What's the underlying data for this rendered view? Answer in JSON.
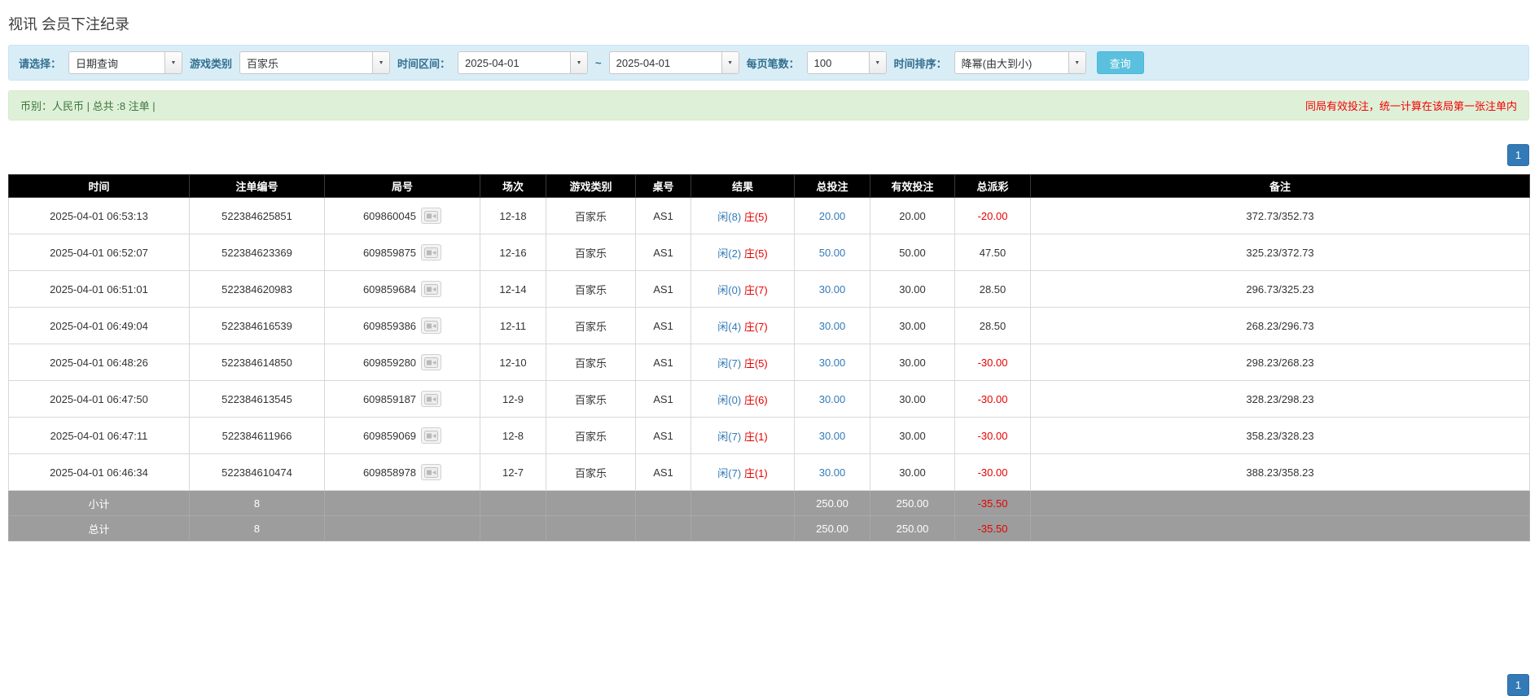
{
  "page": {
    "title": "视讯 会员下注纪录"
  },
  "filters": {
    "select_label": "请选择：",
    "select_value": "日期查询",
    "game_type_label": "游戏类别",
    "game_type_value": "百家乐",
    "date_range_label": "时间区间：",
    "date_from": "2025-04-01",
    "date_separator": "~",
    "date_to": "2025-04-01",
    "page_size_label": "每页笔数：",
    "page_size_value": "100",
    "sort_label": "时间排序：",
    "sort_value": "降幂(由大到小)",
    "search_button": "查询"
  },
  "summary": {
    "left": "币别：人民币 | 总共 :8 注单 |",
    "right": "同局有效投注，统一计算在该局第一张注单内"
  },
  "pagination": {
    "current_page": "1"
  },
  "colors": {
    "link_blue": "#337ab7",
    "negative_red": "#e60000",
    "header_bg": "#000000",
    "footer_bg": "#9d9d9d",
    "filter_bar_bg": "#d9edf7",
    "summary_bar_bg": "#dff0d8"
  },
  "table": {
    "headers": [
      "时间",
      "注单编号",
      "局号",
      "场次",
      "游戏类别",
      "桌号",
      "结果",
      "总投注",
      "有效投注",
      "总派彩",
      "备注"
    ],
    "rows": [
      {
        "time": "2025-04-01 06:53:13",
        "bet_id": "522384625851",
        "round_id": "609860045",
        "session": "12-18",
        "game_type": "百家乐",
        "table_no": "AS1",
        "result": {
          "player": "闲(8)",
          "banker": "庄(5)"
        },
        "total_bet": "20.00",
        "valid_bet": "20.00",
        "payout": "-20.00",
        "remark": "372.73/352.73"
      },
      {
        "time": "2025-04-01 06:52:07",
        "bet_id": "522384623369",
        "round_id": "609859875",
        "session": "12-16",
        "game_type": "百家乐",
        "table_no": "AS1",
        "result": {
          "player": "闲(2)",
          "banker": "庄(5)"
        },
        "total_bet": "50.00",
        "valid_bet": "50.00",
        "payout": "47.50",
        "remark": "325.23/372.73"
      },
      {
        "time": "2025-04-01 06:51:01",
        "bet_id": "522384620983",
        "round_id": "609859684",
        "session": "12-14",
        "game_type": "百家乐",
        "table_no": "AS1",
        "result": {
          "player": "闲(0)",
          "banker": "庄(7)"
        },
        "total_bet": "30.00",
        "valid_bet": "30.00",
        "payout": "28.50",
        "remark": "296.73/325.23"
      },
      {
        "time": "2025-04-01 06:49:04",
        "bet_id": "522384616539",
        "round_id": "609859386",
        "session": "12-11",
        "game_type": "百家乐",
        "table_no": "AS1",
        "result": {
          "player": "闲(4)",
          "banker": "庄(7)"
        },
        "total_bet": "30.00",
        "valid_bet": "30.00",
        "payout": "28.50",
        "remark": "268.23/296.73"
      },
      {
        "time": "2025-04-01 06:48:26",
        "bet_id": "522384614850",
        "round_id": "609859280",
        "session": "12-10",
        "game_type": "百家乐",
        "table_no": "AS1",
        "result": {
          "player": "闲(7)",
          "banker": "庄(5)"
        },
        "total_bet": "30.00",
        "valid_bet": "30.00",
        "payout": "-30.00",
        "remark": "298.23/268.23"
      },
      {
        "time": "2025-04-01 06:47:50",
        "bet_id": "522384613545",
        "round_id": "609859187",
        "session": "12-9",
        "game_type": "百家乐",
        "table_no": "AS1",
        "result": {
          "player": "闲(0)",
          "banker": "庄(6)"
        },
        "total_bet": "30.00",
        "valid_bet": "30.00",
        "payout": "-30.00",
        "remark": "328.23/298.23"
      },
      {
        "time": "2025-04-01 06:47:11",
        "bet_id": "522384611966",
        "round_id": "609859069",
        "session": "12-8",
        "game_type": "百家乐",
        "table_no": "AS1",
        "result": {
          "player": "闲(7)",
          "banker": "庄(1)"
        },
        "total_bet": "30.00",
        "valid_bet": "30.00",
        "payout": "-30.00",
        "remark": "358.23/328.23"
      },
      {
        "time": "2025-04-01 06:46:34",
        "bet_id": "522384610474",
        "round_id": "609858978",
        "session": "12-7",
        "game_type": "百家乐",
        "table_no": "AS1",
        "result": {
          "player": "闲(7)",
          "banker": "庄(1)"
        },
        "total_bet": "30.00",
        "valid_bet": "30.00",
        "payout": "-30.00",
        "remark": "388.23/358.23"
      }
    ],
    "footers": [
      {
        "label": "小计",
        "count": "8",
        "total_bet": "250.00",
        "valid_bet": "250.00",
        "payout": "-35.50"
      },
      {
        "label": "总计",
        "count": "8",
        "total_bet": "250.00",
        "valid_bet": "250.00",
        "payout": "-35.50"
      }
    ]
  }
}
